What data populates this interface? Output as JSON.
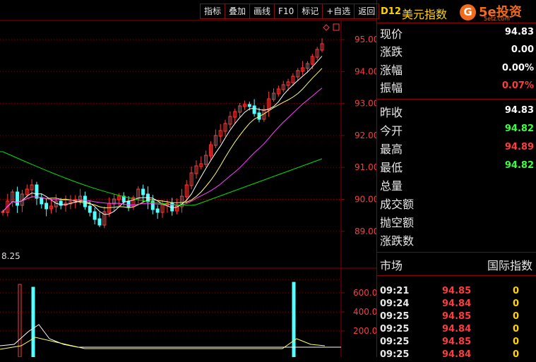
{
  "toolbar": [
    "指标",
    "叠加",
    "画线",
    "F10",
    "标记",
    "+自选",
    "返回"
  ],
  "chart": {
    "price_axis": [
      "95.00",
      "94.00",
      "93.00",
      "92.00",
      "91.00",
      "90.00",
      "89.00"
    ],
    "low_label": "8.25",
    "vol_axis": [
      "600.0",
      "400.0",
      "200.0"
    ],
    "colors": {
      "up": "#ff3c3c",
      "down": "#54ffff",
      "ma5": "#ffffff",
      "ma10": "#ffff66",
      "ma20": "#ff40ff",
      "ma60": "#00e000",
      "grid": "#8b0000"
    }
  },
  "header": {
    "code": "D12",
    "name": "美元指数",
    "logo_mark": "G",
    "logo_brand": "5e投资",
    "logo_sub": "5etz.com"
  },
  "quote": [
    {
      "label": "现价",
      "value": "94.83",
      "color": "#ffffff"
    },
    {
      "label": "涨跌",
      "value": "0.00",
      "color": "#ffffff"
    },
    {
      "label": "涨幅",
      "value": "0.00%",
      "color": "#ffffff"
    },
    {
      "label": "振幅",
      "value": "0.07%",
      "color": "#ff3c3c"
    },
    {
      "label": "昨收",
      "value": "94.83",
      "color": "#ffffff"
    },
    {
      "label": "今开",
      "value": "94.82",
      "color": "#3cff3c"
    },
    {
      "label": "最高",
      "value": "94.89",
      "color": "#ff3c3c"
    },
    {
      "label": "最低",
      "value": "94.82",
      "color": "#3cff3c"
    },
    {
      "label": "总量",
      "value": "",
      "color": "#ffffff"
    },
    {
      "label": "成交额",
      "value": "",
      "color": "#ffffff"
    },
    {
      "label": "抛空额",
      "value": "",
      "color": "#ffffff"
    },
    {
      "label": "涨跌数",
      "value": "",
      "color": "#ffffff"
    }
  ],
  "market": {
    "label": "市场",
    "value": "国际指数"
  },
  "ticks": [
    {
      "time": "09:21",
      "price": "94.85",
      "vol": "0"
    },
    {
      "time": "09:24",
      "price": "94.84",
      "vol": "0"
    },
    {
      "time": "09:25",
      "price": "94.85",
      "vol": "0"
    },
    {
      "time": "09:25",
      "price": "94.84",
      "vol": "0"
    },
    {
      "time": "09:25",
      "price": "94.85",
      "vol": "0"
    },
    {
      "time": "09:25",
      "price": "94.84",
      "vol": "0"
    }
  ]
}
